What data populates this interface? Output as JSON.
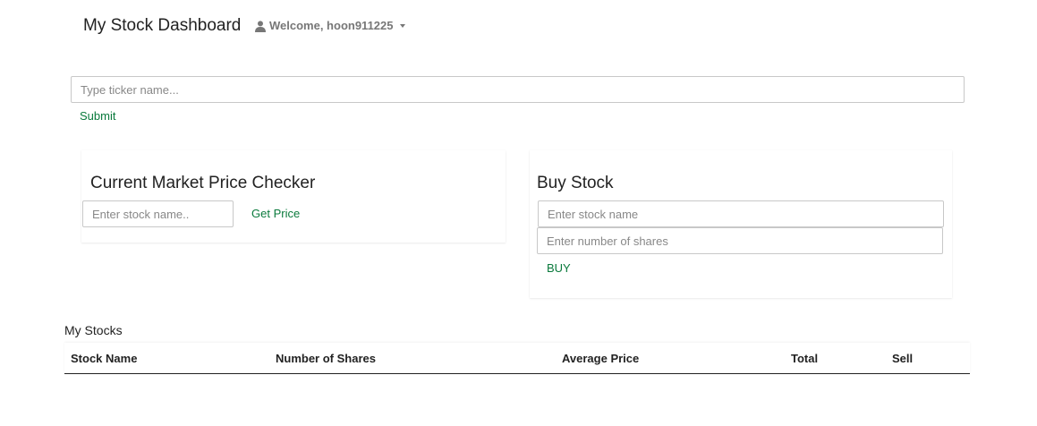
{
  "navbar": {
    "brand": "My Stock Dashboard",
    "user_greeting": "Welcome, hoon911225",
    "user_icon": "user-icon",
    "dropdown_icon": "caret-down-icon"
  },
  "ticker_search": {
    "placeholder": "Type ticker name...",
    "value": "",
    "submit_label": "Submit"
  },
  "price_checker": {
    "title": "Current Market Price Checker",
    "stock_placeholder": "Enter stock name..",
    "stock_value": "",
    "button_label": "Get Price"
  },
  "buy_stock": {
    "title": "Buy Stock",
    "stock_placeholder": "Enter stock name",
    "stock_value": "",
    "shares_placeholder": "Enter number of shares",
    "shares_value": "",
    "button_label": "BUY"
  },
  "my_stocks": {
    "title": "My Stocks",
    "columns": [
      "Stock Name",
      "Number of Shares",
      "Average Price",
      "Total",
      "Sell"
    ],
    "rows": []
  },
  "colors": {
    "accent": "#0a7a3c",
    "text": "#222222",
    "muted": "#777777"
  }
}
